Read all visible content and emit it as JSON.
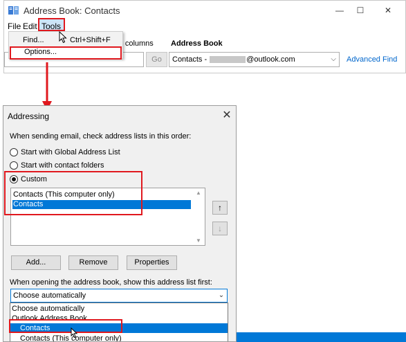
{
  "window": {
    "title": "Address Book: Contacts",
    "controls": {
      "minimize": "—",
      "maximize": "☐",
      "close": "✕"
    }
  },
  "menubar": {
    "file": "File",
    "edit": "Edit",
    "tools": "Tools"
  },
  "tools_menu": {
    "find_label": "Find...",
    "find_shortcut": "Ctrl+Shift+F",
    "options_label": "Options..."
  },
  "toolbar": {
    "more_columns_label": "re columns",
    "go_label": "Go",
    "address_book_label": "Address Book",
    "address_book_value_prefix": "Contacts -",
    "address_book_value_suffix": "@outlook.com",
    "advanced_find": "Advanced Find"
  },
  "dialog": {
    "title": "Addressing",
    "close": "✕",
    "intro": "When sending email, check address lists in this order:",
    "radios": [
      {
        "label": "Start with Global Address List",
        "checked": false
      },
      {
        "label": "Start with contact folders",
        "checked": false
      },
      {
        "label": "Custom",
        "checked": true
      }
    ],
    "address_lists": [
      "Contacts (This computer only)",
      "Contacts"
    ],
    "selected_list_index": 1,
    "move_up": "↑",
    "move_down": "↓",
    "buttons": {
      "add": "Add...",
      "remove": "Remove",
      "properties": "Properties"
    },
    "open_first_label": "When opening the address book, show this address list first:",
    "open_first_value": "Choose automatically",
    "open_first_options": [
      "Choose automatically",
      "Outlook Address Book",
      "Contacts",
      "Contacts (This computer only)"
    ],
    "highlighted_option_index": 2
  },
  "colors": {
    "annotation_red": "#e0181e",
    "selection_blue": "#0078d7",
    "link_blue": "#0066cc"
  }
}
